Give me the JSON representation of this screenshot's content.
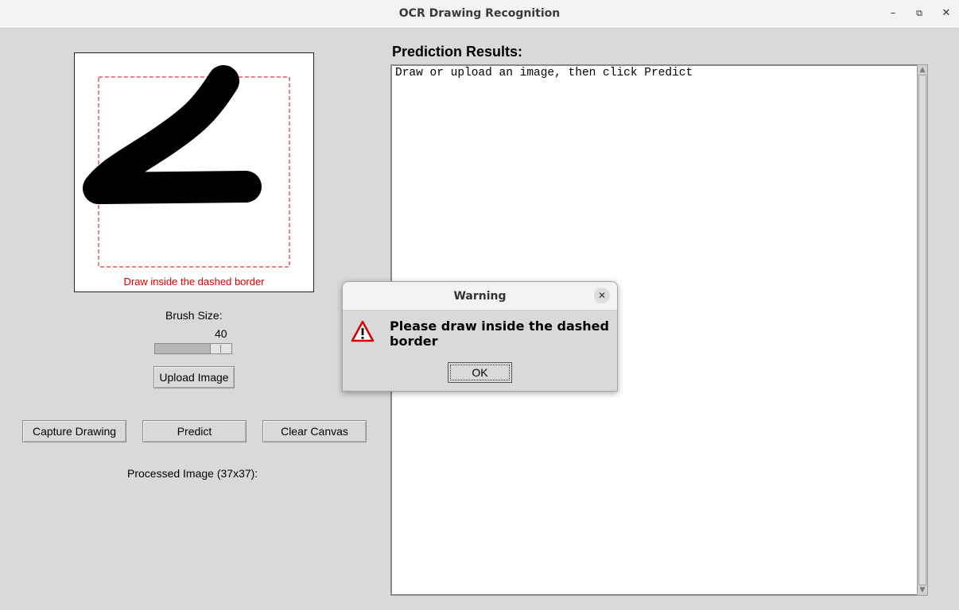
{
  "window": {
    "title": "OCR Drawing Recognition",
    "controls": {
      "minimize": "–",
      "maximize": "⧉",
      "close": "✕"
    }
  },
  "canvas": {
    "hint": "Draw inside the dashed border",
    "hint_color": "#d40000",
    "border_color": "#d40000"
  },
  "brush": {
    "label": "Brush Size:",
    "value": "40"
  },
  "buttons": {
    "upload": "Upload Image",
    "capture": "Capture Drawing",
    "predict": "Predict",
    "clear": "Clear Canvas"
  },
  "processed": {
    "label": "Processed Image (37x37):"
  },
  "results": {
    "title": "Prediction Results:",
    "text": "Draw or upload an image, then click Predict"
  },
  "dialog": {
    "title": "Warning",
    "close": "✕",
    "message": "Please draw inside the dashed border",
    "ok": "OK",
    "icon": "warning-triangle-icon",
    "icon_color": "#d40000"
  }
}
